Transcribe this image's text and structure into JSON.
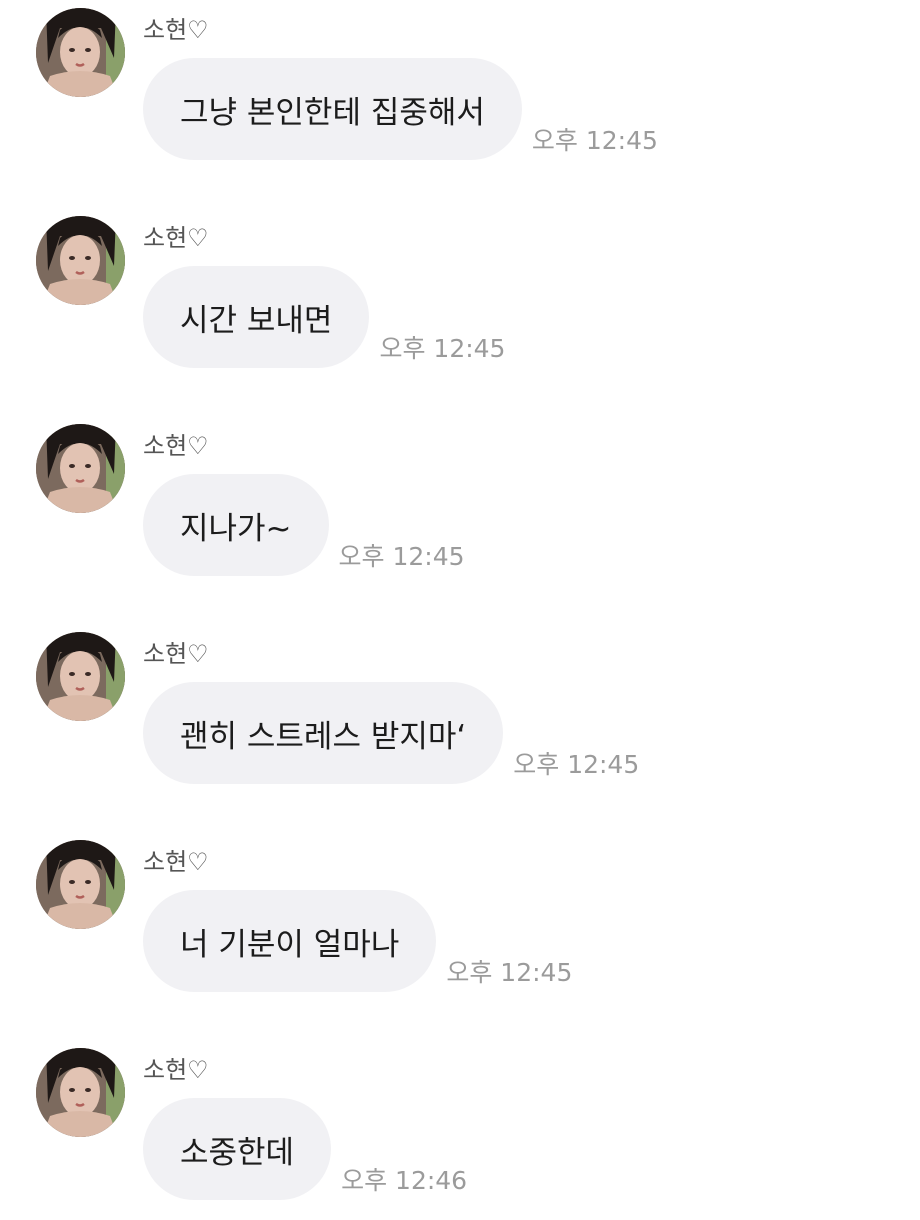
{
  "messages": [
    {
      "sender": "소현♡",
      "text": "그냥 본인한테 집중해서",
      "time": "오후 12:45"
    },
    {
      "sender": "소현♡",
      "text": "시간 보내면",
      "time": "오후 12:45"
    },
    {
      "sender": "소현♡",
      "text": "지나가~",
      "time": "오후 12:45"
    },
    {
      "sender": "소현♡",
      "text": "괜히 스트레스 받지마‘",
      "time": "오후 12:45"
    },
    {
      "sender": "소현♡",
      "text": "너 기분이 얼마나",
      "time": "오후 12:45"
    },
    {
      "sender": "소현♡",
      "text": "소중한데",
      "time": "오후 12:46"
    }
  ],
  "colors": {
    "bubble": "#f1f1f4",
    "time": "#9b9b9b",
    "sender": "#555555",
    "text": "#1c1c1c"
  }
}
